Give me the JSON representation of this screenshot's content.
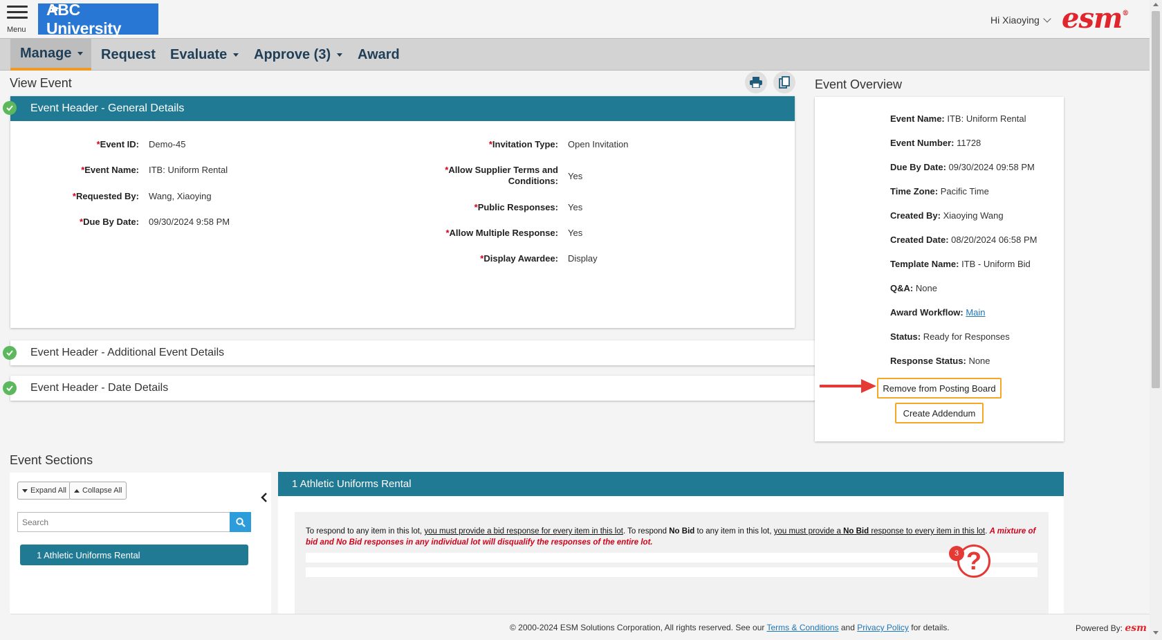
{
  "header": {
    "menu_label": "Menu",
    "logo_text": "ABC University",
    "greeting": "Hi Xiaoying",
    "brand_logo": "esm",
    "brand_reg": "®"
  },
  "nav": {
    "items": [
      {
        "label": "Manage",
        "dropdown": true,
        "active": true
      },
      {
        "label": "Request",
        "dropdown": false
      },
      {
        "label": "Evaluate",
        "dropdown": true
      },
      {
        "label": "Approve (3)",
        "dropdown": true
      },
      {
        "label": "Award",
        "dropdown": false
      }
    ]
  },
  "view_event": {
    "title": "View Event",
    "print_icon": "print-icon",
    "copy_icon": "copy-icon"
  },
  "general": {
    "title": "Event Header - General Details",
    "left_fields": [
      {
        "label": "Event ID:",
        "value": "Demo-45"
      },
      {
        "label": "Event Name:",
        "value": "ITB: Uniform Rental"
      },
      {
        "label": "Requested By:",
        "value": "Wang, Xiaoying"
      },
      {
        "label": "Due By Date:",
        "value": "09/30/2024 9:58 PM"
      }
    ],
    "right_fields": [
      {
        "label": "Invitation Type:",
        "value": "Open Invitation"
      },
      {
        "label_line1": "Allow Supplier Terms and",
        "label_line2": "Conditions:",
        "value": "Yes"
      },
      {
        "label": "Public Responses:",
        "value": "Yes"
      },
      {
        "label": "Allow Multiple Response:",
        "value": "Yes"
      },
      {
        "label": "Display Awardee:",
        "value": "Display"
      }
    ]
  },
  "additional": {
    "title": "Event Header - Additional Event Details"
  },
  "dates": {
    "title": "Event Header - Date Details"
  },
  "overview": {
    "title": "Event Overview",
    "rows": [
      {
        "label": "Event Name:",
        "value": "ITB: Uniform Rental"
      },
      {
        "label": "Event Number:",
        "value": "11728"
      },
      {
        "label": "Due By Date:",
        "value": "09/30/2024 09:58 PM"
      },
      {
        "label": "Time Zone:",
        "value": "Pacific Time"
      },
      {
        "label": "Created By:",
        "value": "Xiaoying Wang"
      },
      {
        "label": "Created Date:",
        "value": "08/20/2024 06:58 PM"
      },
      {
        "label": "Template Name:",
        "value": "ITB - Uniform Bid"
      },
      {
        "label": "Q&A:",
        "value": "None"
      },
      {
        "label": "Award Workflow:",
        "link": "Main"
      },
      {
        "label": "Status:",
        "value": "Ready for Responses"
      },
      {
        "label": "Response Status:",
        "value": "None"
      }
    ],
    "remove_button": "Remove from Posting Board",
    "addendum_button": "Create Addendum"
  },
  "event_sections": {
    "title": "Event Sections",
    "expand_all": "Expand All",
    "collapse_all": "Collapse All",
    "search_placeholder": "Search",
    "items": [
      "1 Athletic Uniforms Rental"
    ],
    "lot_title": "1 Athletic Uniforms Rental",
    "instructions": {
      "p1": "To respond to any item in this lot, ",
      "u1": "you must provide a bid response for every item in this lot",
      "p2": ". To respond ",
      "b1": "No Bid",
      "p3": " to any item in this lot, ",
      "u2a": "you must provide a ",
      "u2b": "No Bid",
      "u2c": " response to every item in this lot",
      "p4": ". ",
      "warn": "A mixture of bid and No Bid responses in any individual lot will disqualify the responses of the entire lot."
    }
  },
  "help": {
    "badge": "3",
    "glyph": "?"
  },
  "footer": {
    "copy_pre": "© 2000-2024 ESM Solutions Corporation, All rights reserved. See our ",
    "terms": "Terms & Conditions",
    "and": " and ",
    "privacy": "Privacy Policy",
    "copy_post": " for details.",
    "powered": "Powered By:",
    "powered_logo": "esm"
  },
  "colors": {
    "accent": "#217a94",
    "logo_bg": "#2977d4",
    "brand_red": "#e0262c",
    "highlight_orange": "#f5a623",
    "check_green": "#5cb85c"
  }
}
